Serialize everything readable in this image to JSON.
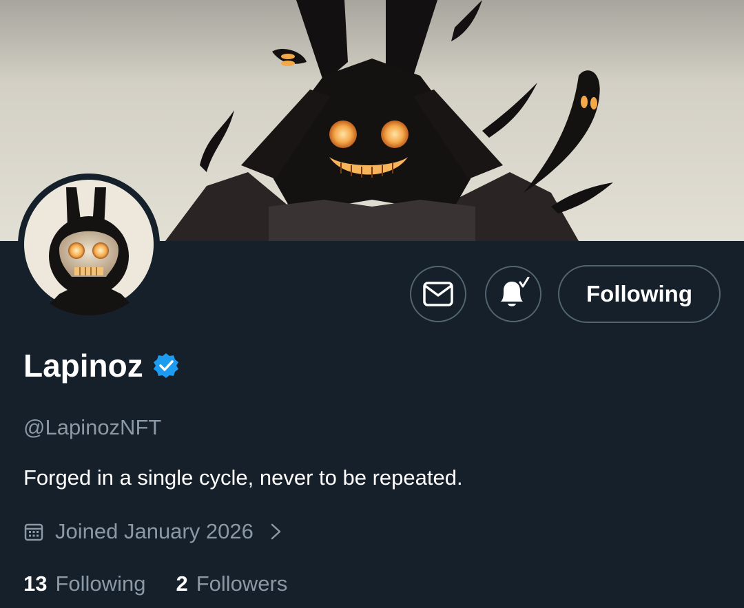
{
  "profile": {
    "display_name": "Lapinoz",
    "handle": "@LapinozNFT",
    "bio": "Forged in a single cycle, never to be repeated.",
    "joined": "Joined January 2026",
    "verified": true
  },
  "actions": {
    "message_icon": "mail-icon",
    "notify_icon": "bell-subscribed-icon",
    "following_label": "Following"
  },
  "stats": {
    "following_count": "13",
    "following_label": "Following",
    "followers_count": "2",
    "followers_label": "Followers"
  },
  "colors": {
    "background": "#15202b",
    "secondary_text": "#8b98a5",
    "border": "#536471",
    "verified_badge": "#1d9bf0",
    "glow": "#f5a84a"
  }
}
